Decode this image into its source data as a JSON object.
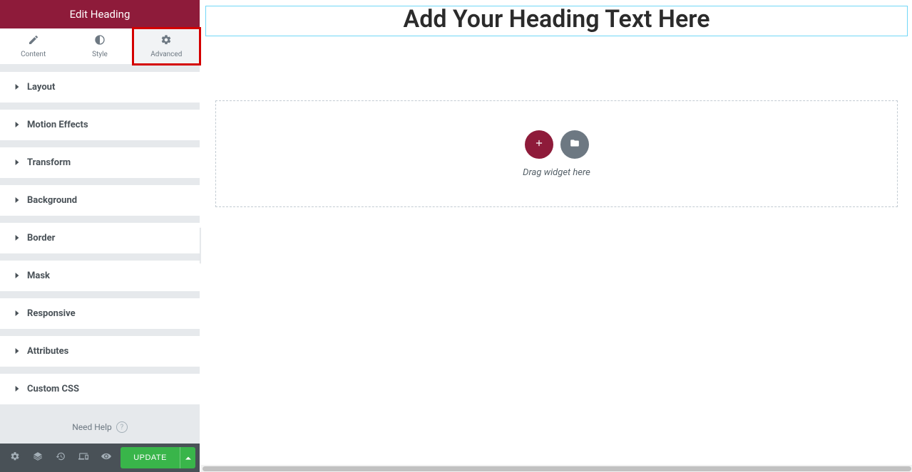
{
  "header": {
    "title": "Edit Heading"
  },
  "tabs": [
    {
      "id": "content",
      "label": "Content"
    },
    {
      "id": "style",
      "label": "Style"
    },
    {
      "id": "advanced",
      "label": "Advanced"
    }
  ],
  "active_tab": "advanced",
  "sections": [
    {
      "id": "layout",
      "label": "Layout"
    },
    {
      "id": "motion-effects",
      "label": "Motion Effects"
    },
    {
      "id": "transform",
      "label": "Transform"
    },
    {
      "id": "background",
      "label": "Background"
    },
    {
      "id": "border",
      "label": "Border"
    },
    {
      "id": "mask",
      "label": "Mask"
    },
    {
      "id": "responsive",
      "label": "Responsive"
    },
    {
      "id": "attributes",
      "label": "Attributes"
    },
    {
      "id": "custom-css",
      "label": "Custom CSS"
    }
  ],
  "need_help": "Need Help",
  "footer": {
    "update_label": "UPDATE"
  },
  "canvas": {
    "heading_text": "Add Your Heading Text Here",
    "drop_hint": "Drag widget here"
  },
  "colors": {
    "brand": "#8e1b3a",
    "accent": "#71d7f7",
    "success": "#39b54a",
    "highlight": "#d40000"
  }
}
